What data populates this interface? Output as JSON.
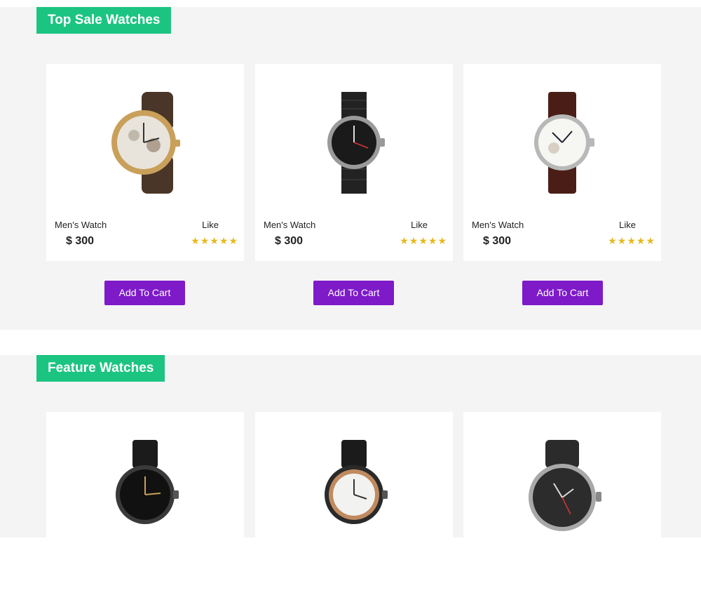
{
  "top_sale": {
    "title": "Top Sale Watches",
    "products": [
      {
        "name": "Men's Watch",
        "like": "Like",
        "price": "$ 300",
        "stars": "★★★★★",
        "cart": "Add To Cart"
      },
      {
        "name": "Men's Watch",
        "like": "Like",
        "price": "$ 300",
        "stars": "★★★★★",
        "cart": "Add To Cart"
      },
      {
        "name": "Men's Watch",
        "like": "Like",
        "price": "$ 300",
        "stars": "★★★★★",
        "cart": "Add To Cart"
      }
    ]
  },
  "feature": {
    "title": "Feature Watches"
  },
  "colors": {
    "accent_green": "#1cc481",
    "button_purple": "#7e1ac8",
    "star_gold": "#e6b91e",
    "section_bg": "#f4f4f4"
  }
}
